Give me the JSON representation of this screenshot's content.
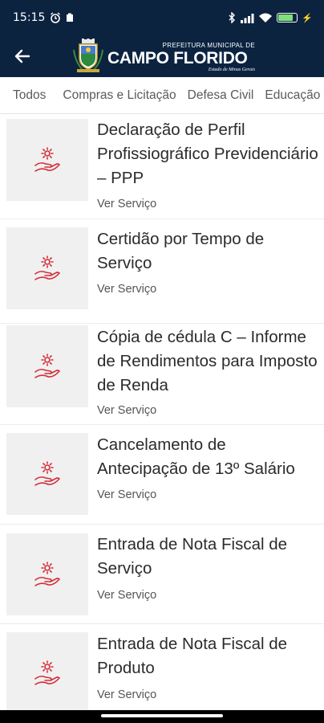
{
  "status": {
    "time": "15:15",
    "battery_label": "⚡"
  },
  "header": {
    "logo_line1": "PREFEITURA MUNICIPAL DE",
    "logo_main": "CAMPO FLORIDO",
    "logo_sub": "Estado de Minas Gerais"
  },
  "tabs": [
    {
      "label": "Todos"
    },
    {
      "label": "Compras e Licitação"
    },
    {
      "label": "Defesa Civil"
    },
    {
      "label": "Educação"
    }
  ],
  "items": [
    {
      "title": "Declaração de Perfil Profissiográfico Previdenciário – PPP",
      "link": "Ver Serviço"
    },
    {
      "title": "Certidão por Tempo de Serviço",
      "link": "Ver Serviço"
    },
    {
      "title": "Cópia de cédula C – Informe de Rendimentos para Imposto de Renda",
      "link": "Ver Serviço"
    },
    {
      "title": "Cancelamento de Antecipação de 13º Salário",
      "link": "Ver Serviço"
    },
    {
      "title": "Entrada de Nota Fiscal de Serviço",
      "link": "Ver Serviço"
    },
    {
      "title": "Entrada de Nota Fiscal de Produto",
      "link": "Ver Serviço"
    }
  ],
  "icons": {
    "service": "hand-gear-icon",
    "back": "back-arrow-icon"
  },
  "colors": {
    "header_bg": "#0c2340",
    "icon_red": "#d32f3a"
  }
}
